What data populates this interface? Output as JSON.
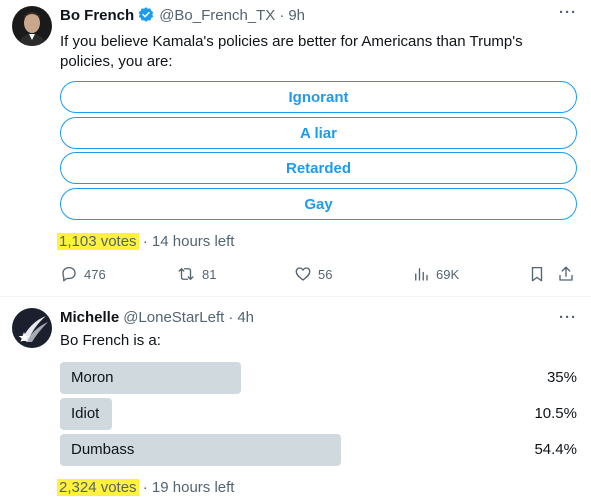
{
  "tweet1": {
    "name": "Bo French",
    "handle": "@Bo_French_TX",
    "time": "9h",
    "text_line1": "If you believe Kamala's policies are better for Americans than Trump's",
    "text_line2": "policies, you are:",
    "poll_options": [
      "Ignorant",
      "A liar",
      "Retarded",
      "Gay"
    ],
    "votes": "1,103 votes",
    "time_left": "14 hours left",
    "actions": {
      "replies": "476",
      "reposts": "81",
      "likes": "56",
      "views": "69K"
    }
  },
  "tweet2": {
    "name": "Michelle",
    "handle": "@LoneStarLeft",
    "time": "4h",
    "text": "Bo French is a:",
    "results": [
      {
        "label": "Moron",
        "pct": "35%",
        "value": 35
      },
      {
        "label": "Idiot",
        "pct": "10.5%",
        "value": 10.5
      },
      {
        "label": "Dumbass",
        "pct": "54.4%",
        "value": 54.4
      }
    ],
    "votes": "2,324 votes",
    "time_left": "19 hours left"
  },
  "colors": {
    "accent": "#1d9bf0",
    "highlight": "#fff238",
    "bar": "#cfd9de",
    "muted": "#536471"
  }
}
